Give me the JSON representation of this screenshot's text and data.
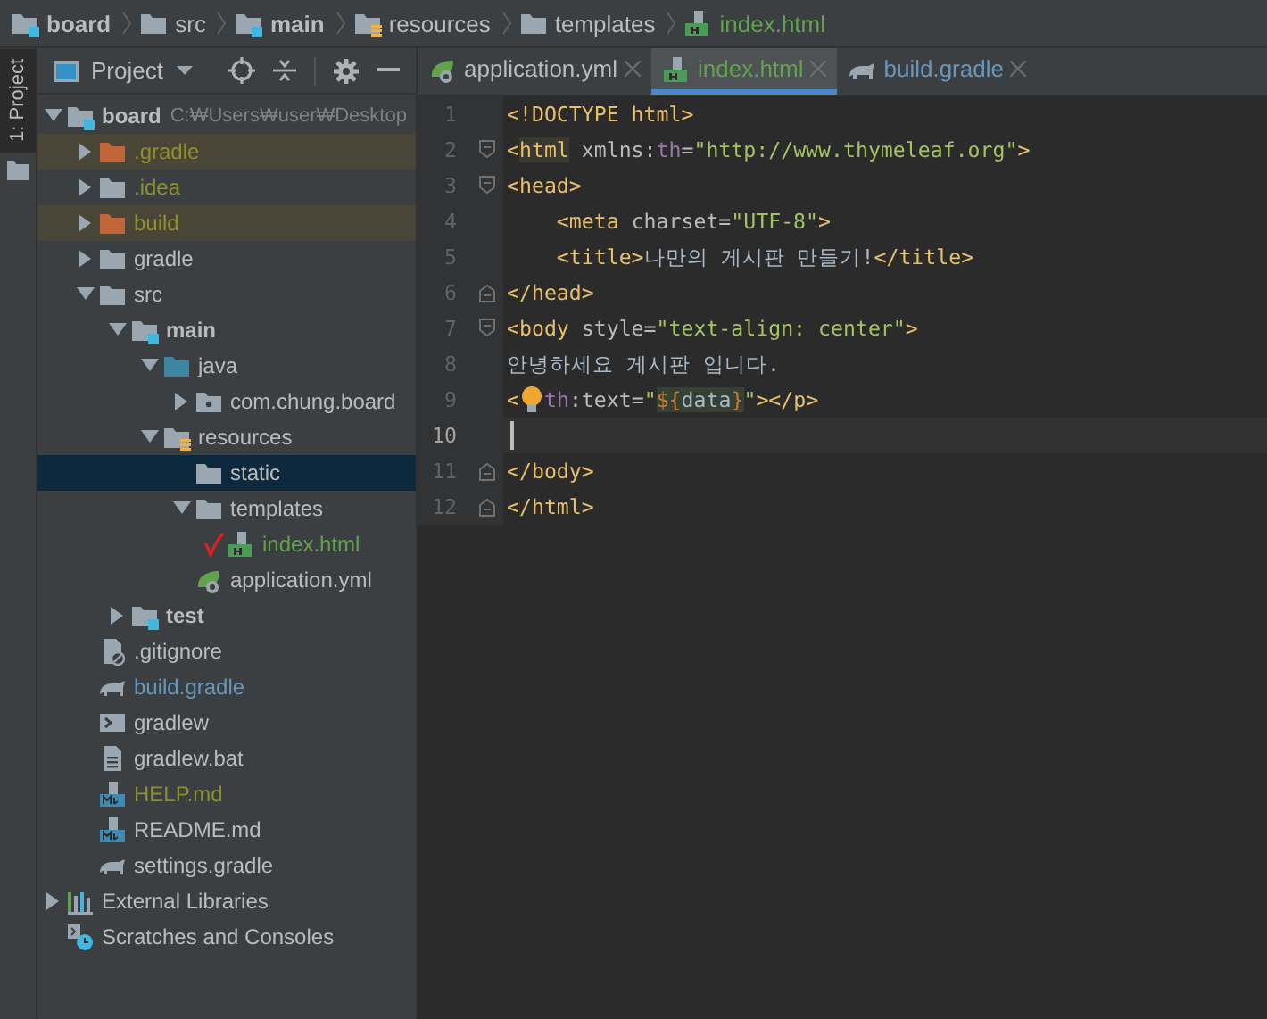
{
  "breadcrumbs": [
    {
      "label": "board",
      "kind": "module",
      "color": "#bbbbbb"
    },
    {
      "label": "src",
      "kind": "folder",
      "color": "#bbbbbb"
    },
    {
      "label": "main",
      "kind": "module",
      "color": "#bbbbbb"
    },
    {
      "label": "resources",
      "kind": "resources",
      "color": "#bbbbbb"
    },
    {
      "label": "templates",
      "kind": "folder",
      "color": "#bbbbbb"
    },
    {
      "label": "index.html",
      "kind": "html",
      "color": "#62a24f"
    }
  ],
  "tool_windows": [
    {
      "label": "1: Project",
      "selected": true
    }
  ],
  "project_panel": {
    "title": "Project"
  },
  "tree": [
    {
      "label": "board",
      "kind": "module",
      "hint": "C:₩Users₩user₩Desktop",
      "expanded": true,
      "selected": false,
      "check": false,
      "color": "#bbbbbb",
      "children": [
        {
          "label": ".gradle",
          "kind": "excluded",
          "expanded": false,
          "selected": false,
          "check": false,
          "color": "#8f8f2b"
        },
        {
          "label": ".idea",
          "kind": "folder",
          "expanded": false,
          "selected": false,
          "check": false,
          "color": "#8f8f2b"
        },
        {
          "label": "build",
          "kind": "excluded",
          "expanded": false,
          "selected": false,
          "check": false,
          "color": "#8f8f2b"
        },
        {
          "label": "gradle",
          "kind": "folder",
          "expanded": false,
          "selected": false,
          "check": false,
          "color": "#bbbbbb"
        },
        {
          "label": "src",
          "kind": "folder",
          "expanded": true,
          "selected": false,
          "check": false,
          "color": "#bbbbbb",
          "children": [
            {
              "label": "main",
              "kind": "module",
              "expanded": true,
              "selected": false,
              "check": false,
              "color": "#bbbbbb",
              "children": [
                {
                  "label": "java",
                  "kind": "source",
                  "expanded": true,
                  "selected": false,
                  "check": false,
                  "color": "#bbbbbb",
                  "children": [
                    {
                      "label": "com.chung.board",
                      "kind": "package",
                      "expanded": false,
                      "selected": false,
                      "check": false,
                      "color": "#bbbbbb"
                    }
                  ]
                },
                {
                  "label": "resources",
                  "kind": "resources",
                  "expanded": true,
                  "selected": false,
                  "check": false,
                  "color": "#bbbbbb",
                  "children": [
                    {
                      "label": "static",
                      "kind": "folder",
                      "selected": true,
                      "check": false,
                      "color": "#bbbbbb"
                    },
                    {
                      "label": "templates",
                      "kind": "folder",
                      "expanded": true,
                      "selected": false,
                      "check": false,
                      "color": "#bbbbbb",
                      "children": [
                        {
                          "label": "index.html",
                          "kind": "html",
                          "selected": false,
                          "check": true,
                          "color": "#62a24f"
                        }
                      ]
                    },
                    {
                      "label": "application.yml",
                      "kind": "yml",
                      "selected": false,
                      "check": false,
                      "color": "#bbbbbb"
                    }
                  ]
                }
              ]
            },
            {
              "label": "test",
              "kind": "module",
              "expanded": false,
              "selected": false,
              "check": false,
              "color": "#bbbbbb"
            }
          ]
        },
        {
          "label": ".gitignore",
          "kind": "ignore",
          "selected": false,
          "check": false,
          "color": "#bbbbbb"
        },
        {
          "label": "build.gradle",
          "kind": "gradle",
          "selected": false,
          "check": false,
          "color": "#6897bb"
        },
        {
          "label": "gradlew",
          "kind": "terminal",
          "selected": false,
          "check": false,
          "color": "#bbbbbb"
        },
        {
          "label": "gradlew.bat",
          "kind": "text",
          "selected": false,
          "check": false,
          "color": "#bbbbbb"
        },
        {
          "label": "HELP.md",
          "kind": "md",
          "selected": false,
          "check": false,
          "color": "#8f8f2b"
        },
        {
          "label": "README.md",
          "kind": "md",
          "selected": false,
          "check": false,
          "color": "#bbbbbb"
        },
        {
          "label": "settings.gradle",
          "kind": "gradle",
          "selected": false,
          "check": false,
          "color": "#bbbbbb"
        }
      ]
    },
    {
      "label": "External Libraries",
      "kind": "libraries",
      "expanded": false,
      "selected": false,
      "check": false,
      "color": "#bbbbbb"
    },
    {
      "label": "Scratches and Consoles",
      "kind": "scratches",
      "selected": false,
      "check": false,
      "color": "#bbbbbb"
    }
  ],
  "editor_tabs": [
    {
      "label": "application.yml",
      "kind": "yml",
      "color": "#bbbbbb",
      "selected": false
    },
    {
      "label": "index.html",
      "kind": "html",
      "color": "#62a24f",
      "selected": true
    },
    {
      "label": "build.gradle",
      "kind": "gradle",
      "color": "#6897bb",
      "selected": false
    }
  ],
  "code_lines": [
    {
      "number": "1",
      "kind": "plain",
      "current": false,
      "tokens": [
        {
          "kind": "tag",
          "text": "<!DOCTYPE html>"
        }
      ]
    },
    {
      "number": "2",
      "kind": "fold-start",
      "current": false,
      "tokens": [
        {
          "kind": "tag",
          "text": "<"
        },
        {
          "kind": "tag-match",
          "text": "html"
        },
        {
          "kind": "attr",
          "text": " xmlns:"
        },
        {
          "kind": "ns",
          "text": "th"
        },
        {
          "kind": "attr",
          "text": "="
        },
        {
          "kind": "string",
          "text": "\"http://www.thymeleaf.org\""
        },
        {
          "kind": "tag",
          "text": ">"
        }
      ]
    },
    {
      "number": "3",
      "kind": "fold-start",
      "current": false,
      "tokens": [
        {
          "kind": "tag",
          "text": "<head>"
        }
      ]
    },
    {
      "number": "4",
      "kind": "plain",
      "current": false,
      "tokens": [
        {
          "kind": "tag",
          "text": "    <meta "
        },
        {
          "kind": "attr",
          "text": "charset="
        },
        {
          "kind": "string",
          "text": "\"UTF-8\""
        },
        {
          "kind": "tag",
          "text": ">"
        }
      ]
    },
    {
      "number": "5",
      "kind": "plain",
      "current": false,
      "tokens": [
        {
          "kind": "tag",
          "text": "    <title>"
        },
        {
          "kind": "text",
          "text": "나만의 게시판 만들기!"
        },
        {
          "kind": "tag",
          "text": "</title>"
        }
      ]
    },
    {
      "number": "6",
      "kind": "fold-end",
      "current": false,
      "tokens": [
        {
          "kind": "tag",
          "text": "</head>"
        }
      ]
    },
    {
      "number": "7",
      "kind": "fold-start",
      "current": false,
      "tokens": [
        {
          "kind": "tag",
          "text": "<body "
        },
        {
          "kind": "attr",
          "text": "style="
        },
        {
          "kind": "string",
          "text": "\"text-align: center\""
        },
        {
          "kind": "tag",
          "text": ">"
        }
      ]
    },
    {
      "number": "8",
      "kind": "plain",
      "current": false,
      "tokens": [
        {
          "kind": "text",
          "text": "안녕하세요 게시판 입니다."
        }
      ]
    },
    {
      "number": "9",
      "kind": "plain",
      "current": false,
      "tokens": [
        {
          "kind": "tag",
          "text": "<"
        },
        {
          "kind": "bulb"
        },
        {
          "kind": "ns",
          "text": "th"
        },
        {
          "kind": "attr",
          "text": ":text="
        },
        {
          "kind": "string",
          "text": "\""
        },
        {
          "kind": "expr-brace",
          "text": "${"
        },
        {
          "kind": "expr-var",
          "text": "data"
        },
        {
          "kind": "expr-brace",
          "text": "}"
        },
        {
          "kind": "string",
          "text": "\""
        },
        {
          "kind": "tag",
          "text": "></p>"
        }
      ]
    },
    {
      "number": "10",
      "kind": "plain",
      "current": true
    },
    {
      "number": "11",
      "kind": "fold-end",
      "current": false,
      "tokens": [
        {
          "kind": "tag",
          "text": "</body>"
        }
      ]
    },
    {
      "number": "12",
      "kind": "fold-end",
      "current": false,
      "tokens": [
        {
          "kind": "tag",
          "text": "</html>"
        }
      ]
    }
  ]
}
